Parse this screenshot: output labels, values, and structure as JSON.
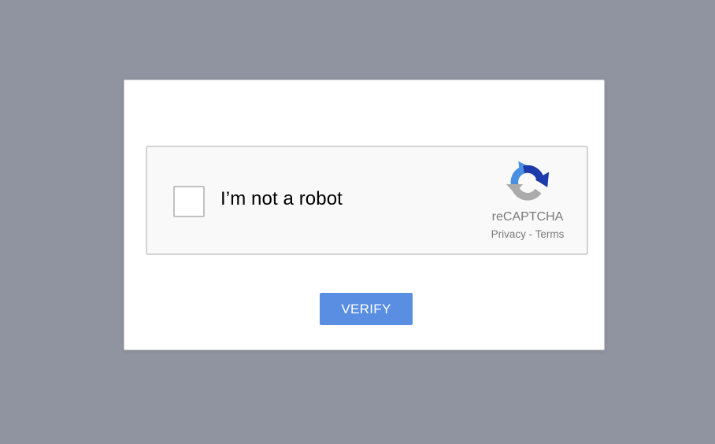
{
  "captcha": {
    "checkbox_label": "I’m not a robot",
    "brand_name": "reCAPTCHA",
    "privacy_link": "Privacy",
    "separator": " - ",
    "terms_link": "Terms",
    "logo_icon": "recaptcha-logo-icon",
    "checked": false
  },
  "dialog": {
    "verify_label": "VERIFY"
  },
  "colors": {
    "page_background": "#9094a0",
    "verify_button": "#5a8ee2",
    "logo_blue": "#4a90e2",
    "logo_dark_blue": "#1c3aa9",
    "logo_gray": "#ababab"
  }
}
